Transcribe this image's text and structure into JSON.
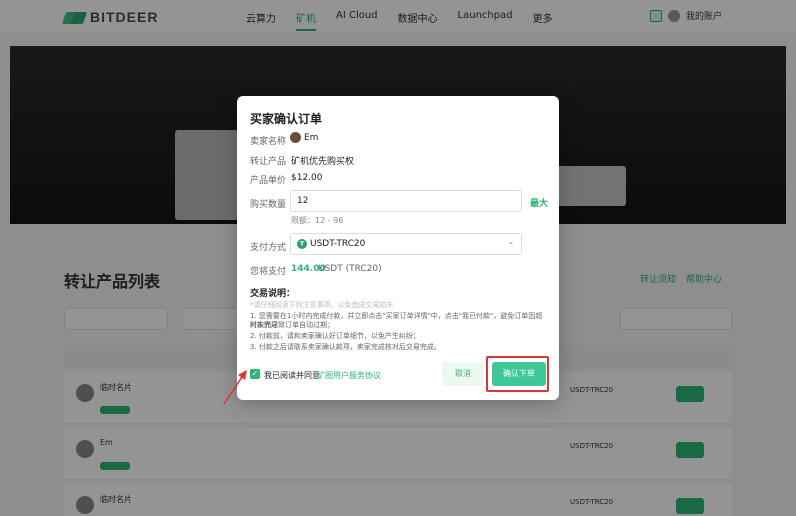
{
  "nav": {
    "logo": "BITDEER",
    "items": [
      "云算力",
      "矿机",
      "AI Cloud",
      "数据中心",
      "Launchpad",
      "更多"
    ],
    "user": "我的账户"
  },
  "page": {
    "section_title": "转让产品列表",
    "links": [
      "转让须知",
      "帮助中心"
    ],
    "rows": [
      {
        "name": "临时名片"
      },
      {
        "name": "Em"
      },
      {
        "name": "临时名片"
      }
    ],
    "pay_label": "USDT-TRC20"
  },
  "modal": {
    "title": "买家确认订单",
    "seller_label": "卖家名称",
    "seller_name": "Em",
    "product_label": "转让产品",
    "product_value": "矿机优先购买权",
    "price_label": "产品单价",
    "price_value": "$12.00",
    "qty_label": "购买数量",
    "qty_value": "12",
    "qty_max": "最大",
    "qty_range": "限额：12 - 96",
    "pay_label": "支付方式",
    "pay_value": "USDT-TRC20",
    "total_label": "您将支付",
    "total_amount": "144.00",
    "total_unit": "USDT (TRC20)",
    "notice_title": "交易说明：",
    "notice_hint": "*请仔细阅读下列注意事项，以免造成交易损失",
    "notice_1": "1. 您需要在1小时内完成付款，并立即点击\"买家订单详情\"中，点击\"我已付款\"，避免订单因超时未完成",
    "notice_1b": "付款而导致订单自动过期；",
    "notice_2": "2. 付款前，请和卖家确认好订单细节，以免产生纠纷；",
    "notice_3": "3. 付款之后请联系卖家确认款项，卖家完成核对后交易完成。",
    "agree_text": "我已阅读并同意",
    "agree_link": "矿圈用户服务协议",
    "cancel": "取消",
    "confirm": "确认下单"
  }
}
